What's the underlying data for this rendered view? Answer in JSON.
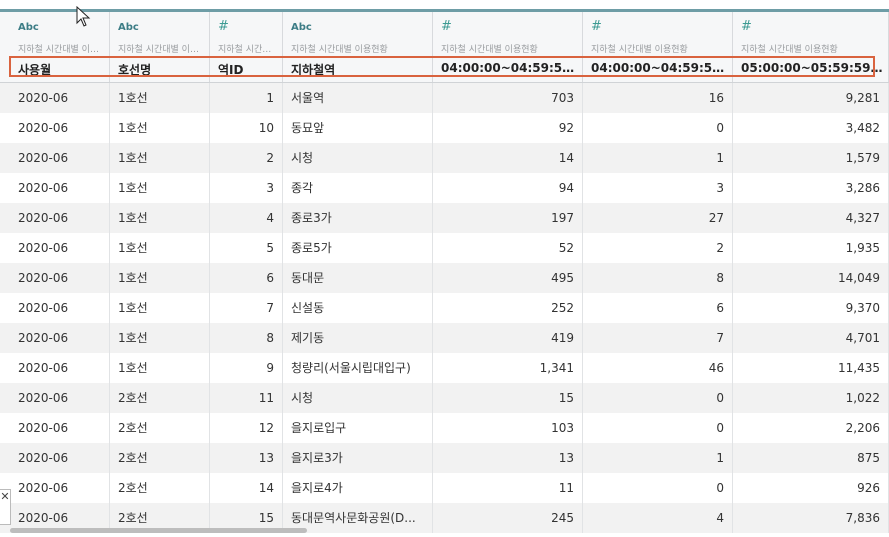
{
  "columns": [
    {
      "type": "Abc",
      "source": "지하철 시간대별 이용현황",
      "name": "사용월",
      "numeric": false
    },
    {
      "type": "Abc",
      "source": "지하철 시간대별 이용현황",
      "name": "호선명",
      "numeric": false
    },
    {
      "type": "#",
      "source": "지하철 시간대별 이용현황",
      "name": "역ID",
      "numeric": true
    },
    {
      "type": "Abc",
      "source": "지하철 시간대별 이용현황",
      "name": "지하철역",
      "numeric": false
    },
    {
      "type": "#",
      "source": "지하철 시간대별 이용현황",
      "name": "04:00:00~04:59:59...",
      "numeric": true
    },
    {
      "type": "#",
      "source": "지하철 시간대별 이용현황",
      "name": "04:00:00~04:59:59...",
      "numeric": true
    },
    {
      "type": "#",
      "source": "지하철 시간대별 이용현황",
      "name": "05:00:00~05:59:59...",
      "numeric": true
    }
  ],
  "rows": [
    [
      "2020-06",
      "1호선",
      "1",
      "서울역",
      "703",
      "16",
      "9,281"
    ],
    [
      "2020-06",
      "1호선",
      "10",
      "동묘앞",
      "92",
      "0",
      "3,482"
    ],
    [
      "2020-06",
      "1호선",
      "2",
      "시청",
      "14",
      "1",
      "1,579"
    ],
    [
      "2020-06",
      "1호선",
      "3",
      "종각",
      "94",
      "3",
      "3,286"
    ],
    [
      "2020-06",
      "1호선",
      "4",
      "종로3가",
      "197",
      "27",
      "4,327"
    ],
    [
      "2020-06",
      "1호선",
      "5",
      "종로5가",
      "52",
      "2",
      "1,935"
    ],
    [
      "2020-06",
      "1호선",
      "6",
      "동대문",
      "495",
      "8",
      "14,049"
    ],
    [
      "2020-06",
      "1호선",
      "7",
      "신설동",
      "252",
      "6",
      "9,370"
    ],
    [
      "2020-06",
      "1호선",
      "8",
      "제기동",
      "419",
      "7",
      "4,701"
    ],
    [
      "2020-06",
      "1호선",
      "9",
      "청량리(서울시립대입구)",
      "1,341",
      "46",
      "11,435"
    ],
    [
      "2020-06",
      "2호선",
      "11",
      "시청",
      "15",
      "0",
      "1,022"
    ],
    [
      "2020-06",
      "2호선",
      "12",
      "을지로입구",
      "103",
      "0",
      "2,206"
    ],
    [
      "2020-06",
      "2호선",
      "13",
      "을지로3가",
      "13",
      "1",
      "875"
    ],
    [
      "2020-06",
      "2호선",
      "14",
      "을지로4가",
      "11",
      "0",
      "926"
    ],
    [
      "2020-06",
      "2호선",
      "15",
      "동대문역사문화공원(D...",
      "245",
      "4",
      "7,836"
    ]
  ],
  "close_glyph": "✕",
  "colors": {
    "accent": "#6e9da6",
    "highlight": "#d9633f",
    "type_icon": "#3d7d86"
  }
}
